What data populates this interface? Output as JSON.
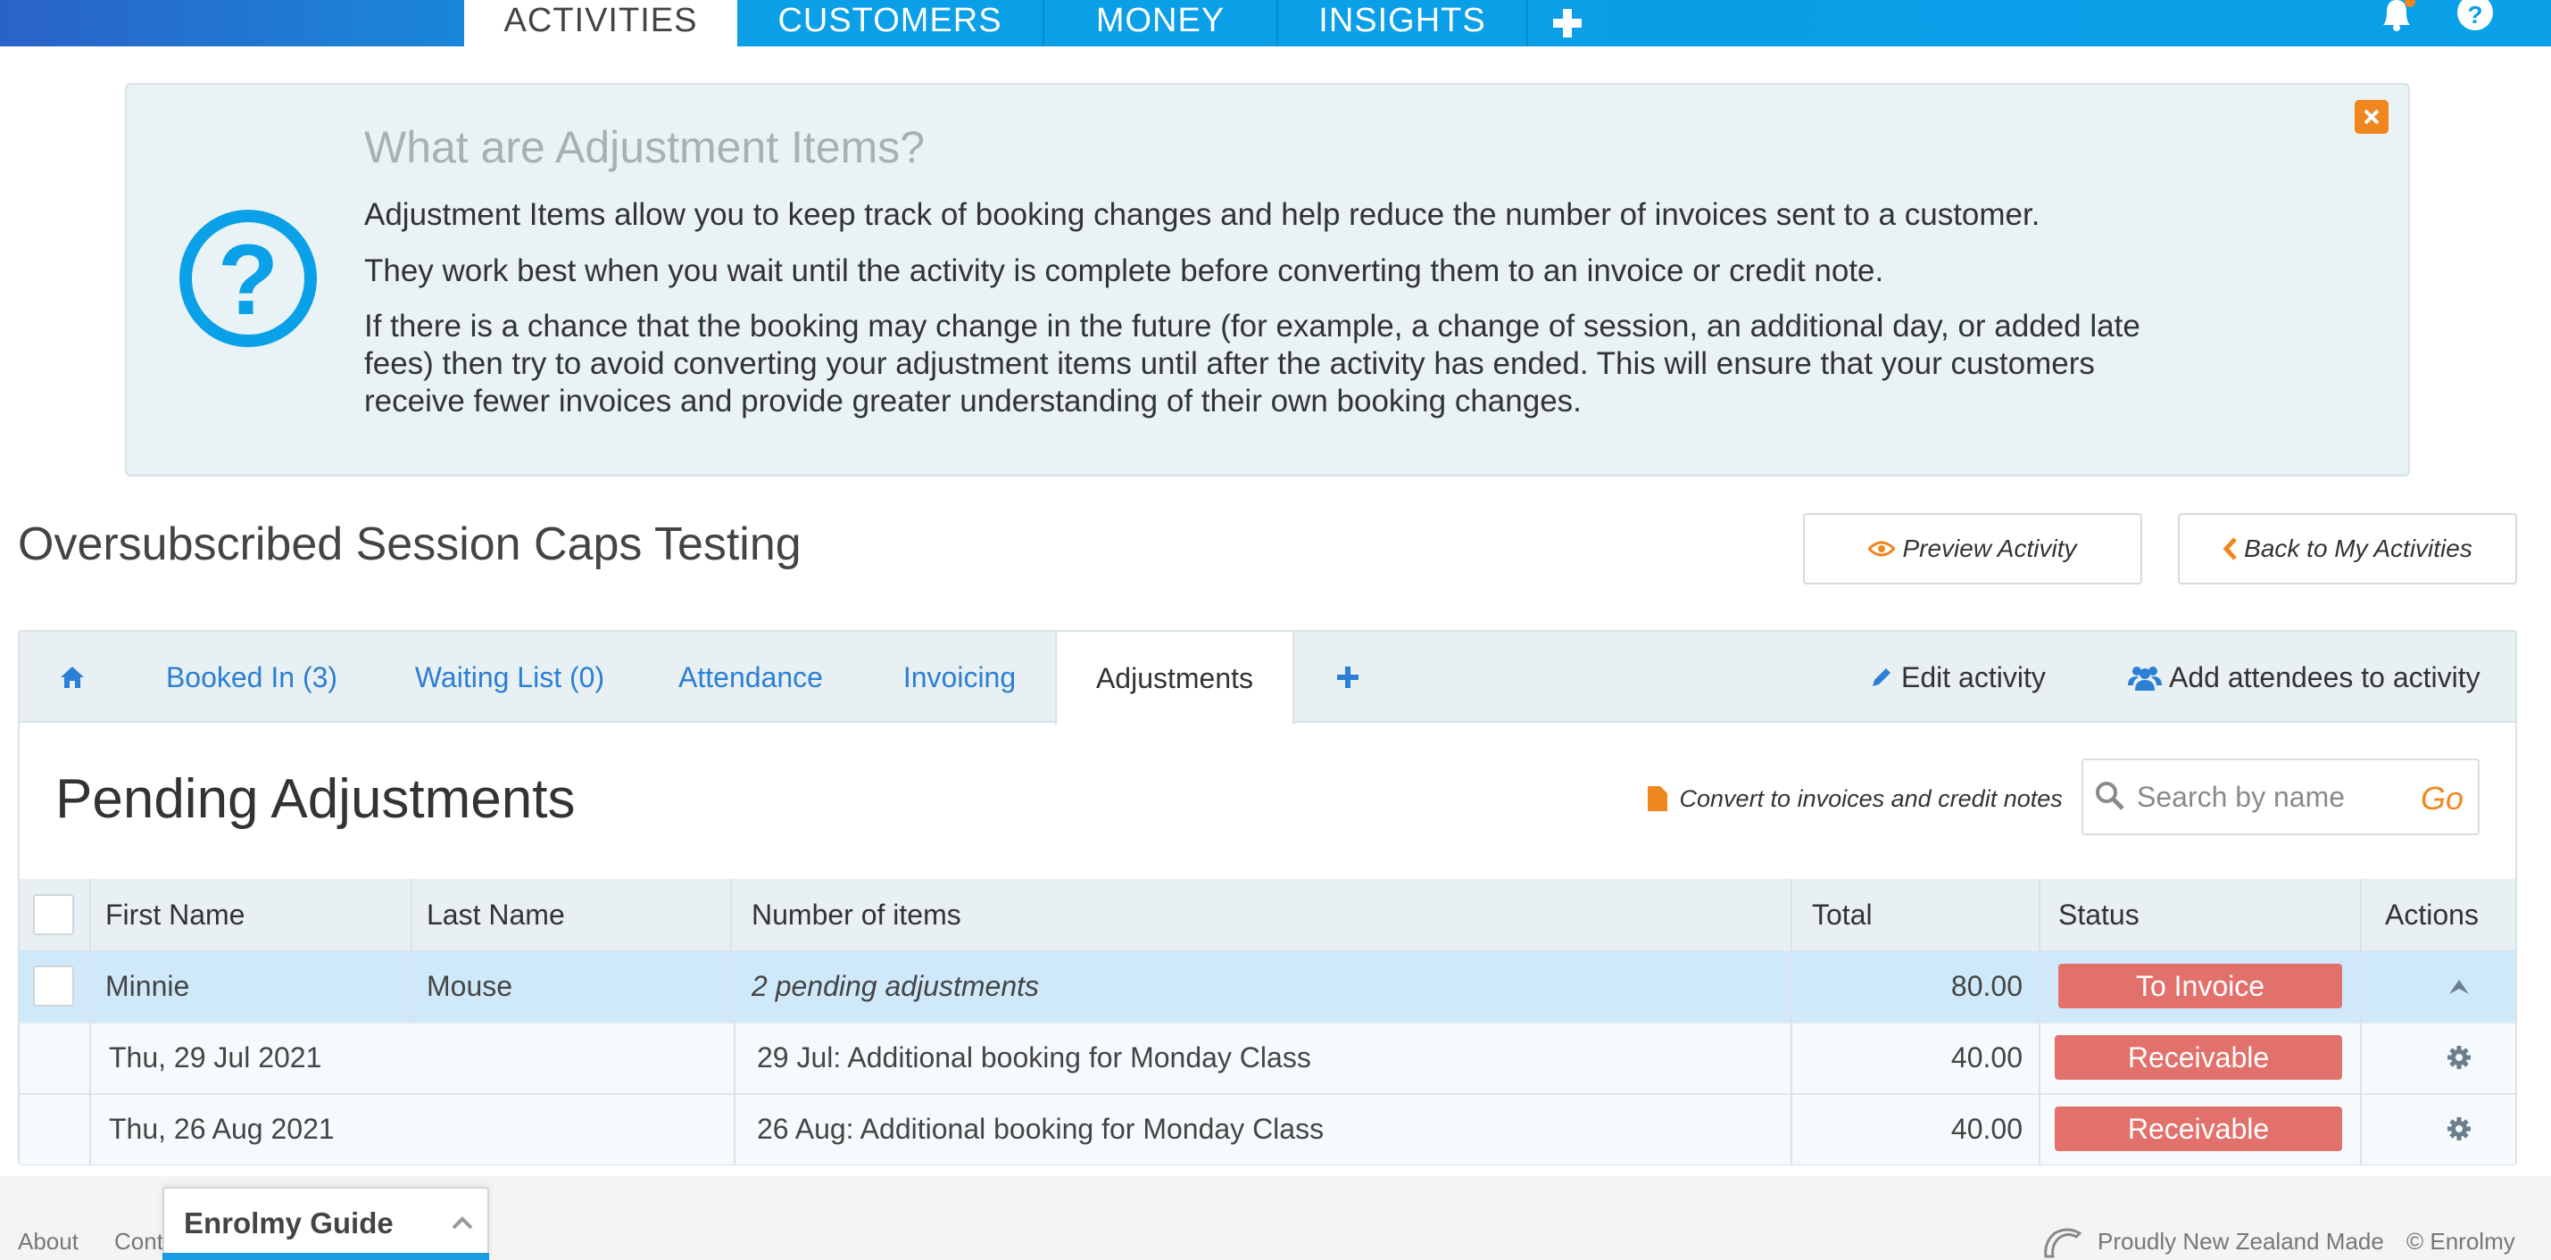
{
  "nav": {
    "tabs": [
      {
        "label": "ACTIVITIES",
        "active": true
      },
      {
        "label": "CUSTOMERS",
        "active": false
      },
      {
        "label": "MONEY",
        "active": false
      },
      {
        "label": "INSIGHTS",
        "active": false
      }
    ],
    "plus_icon": "plus-icon",
    "bell_icon": "bell-icon",
    "help_icon": "help-icon"
  },
  "info": {
    "title": "What are Adjustment Items?",
    "p1": "Adjustment Items allow you to keep track of booking changes and help reduce the number of invoices sent to a customer.",
    "p2": "They work best when you wait until the activity is complete before converting them to an invoice or credit note.",
    "p3": "If there is a chance that the booking may change in the future (for example, a change of session, an additional day, or added late fees) then try to avoid converting your adjustment items until after the activity has ended. This will ensure that your customers receive fewer invoices and provide greater understanding of their own booking changes.",
    "close_icon": "close-icon",
    "question_icon": "question-circle-icon"
  },
  "page": {
    "title": "Oversubscribed Session Caps Testing",
    "preview_label": "Preview Activity",
    "back_label": "Back to My Activities"
  },
  "tabs": {
    "home_icon": "home-icon",
    "items": [
      {
        "label": "Booked In (3)"
      },
      {
        "label": "Waiting List (0)"
      },
      {
        "label": "Attendance"
      },
      {
        "label": "Invoicing"
      },
      {
        "label": "Adjustments",
        "active": true
      }
    ],
    "edit_label": "Edit activity",
    "add_label": "Add attendees to activity"
  },
  "section": {
    "title": "Pending Adjustments",
    "convert_label": "Convert to invoices and credit notes",
    "search_placeholder": "Search by name",
    "go_label": "Go"
  },
  "table": {
    "headers": {
      "first": "First Name",
      "last": "Last Name",
      "items": "Number of items",
      "total": "Total",
      "status": "Status",
      "actions": "Actions"
    },
    "row": {
      "first": "Minnie",
      "last": "Mouse",
      "items": "2 pending adjustments",
      "total": "80.00",
      "status": "To Invoice"
    },
    "subrows": [
      {
        "date": "Thu, 29 Jul 2021",
        "desc": "29 Jul: Additional booking for Monday Class",
        "total": "40.00",
        "status": "Receivable"
      },
      {
        "date": "Thu, 26 Aug 2021",
        "desc": "26 Aug: Additional booking for Monday Class",
        "total": "40.00",
        "status": "Receivable"
      }
    ],
    "status_color": "#e2716c"
  },
  "footer": {
    "about": "About",
    "contact": "Cont",
    "guide_title": "Enrolmy Guide",
    "nz": "Proudly New Zealand Made",
    "copyright": "© Enrolmy"
  },
  "colors": {
    "brand_blue": "#0aa1e8",
    "accent_orange": "#f0861e",
    "link_blue": "#2b7fd4"
  }
}
